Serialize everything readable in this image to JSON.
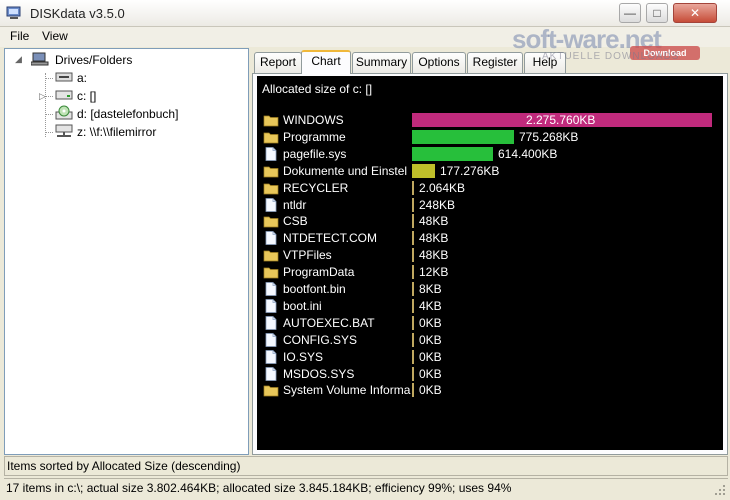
{
  "window": {
    "title": "DISKdata v3.5.0"
  },
  "watermark": {
    "text": "soft-ware.net",
    "badge": "Download",
    "sub": "AKTUELLE DOWNLOADS"
  },
  "menu": [
    {
      "label": "File"
    },
    {
      "label": "View"
    }
  ],
  "tree": {
    "root": "Drives/Folders",
    "items": [
      {
        "label": "a:",
        "icon": "floppy-drive-icon"
      },
      {
        "label": "c: []",
        "icon": "hard-drive-icon"
      },
      {
        "label": "d: [dastelefonbuch]",
        "icon": "cd-drive-icon"
      },
      {
        "label": "z: \\\\f:\\\\filemirror",
        "icon": "network-drive-icon"
      }
    ]
  },
  "tabs": [
    {
      "label": "Report"
    },
    {
      "label": "Chart"
    },
    {
      "label": "Summary"
    },
    {
      "label": "Options"
    },
    {
      "label": "Register"
    },
    {
      "label": "Help"
    }
  ],
  "chart": {
    "title": "Allocated size of c: []",
    "colors": {
      "magenta": "#c02a7c",
      "green": "#27bf3b",
      "olive": "#bfbf2a",
      "tick": "#c0a860"
    },
    "rows": [
      {
        "name": "WINDOWS",
        "value": "2.275.760KB",
        "kb": 2275760,
        "kind": "folder",
        "color": "#c02a7c",
        "label_inside": true
      },
      {
        "name": "Programme",
        "value": "775.268KB",
        "kb": 775268,
        "kind": "folder",
        "color": "#27bf3b"
      },
      {
        "name": "pagefile.sys",
        "value": "614.400KB",
        "kb": 614400,
        "kind": "file",
        "color": "#27bf3b"
      },
      {
        "name": "Dokumente und Einstel",
        "value": "177.276KB",
        "kb": 177276,
        "kind": "folder",
        "color": "#bfbf2a"
      },
      {
        "name": "RECYCLER",
        "value": "2.064KB",
        "kb": 2064,
        "kind": "folder",
        "color": "#c0a860"
      },
      {
        "name": "ntldr",
        "value": "248KB",
        "kb": 248,
        "kind": "file",
        "color": "#c0a860"
      },
      {
        "name": "CSB",
        "value": "48KB",
        "kb": 48,
        "kind": "folder",
        "color": "#c0a860"
      },
      {
        "name": "NTDETECT.COM",
        "value": "48KB",
        "kb": 48,
        "kind": "file",
        "color": "#c0a860"
      },
      {
        "name": "VTPFiles",
        "value": "48KB",
        "kb": 48,
        "kind": "folder",
        "color": "#c0a860"
      },
      {
        "name": "ProgramData",
        "value": "12KB",
        "kb": 12,
        "kind": "folder",
        "color": "#c0a860"
      },
      {
        "name": "bootfont.bin",
        "value": "8KB",
        "kb": 8,
        "kind": "file",
        "color": "#c0a860"
      },
      {
        "name": "boot.ini",
        "value": "4KB",
        "kb": 4,
        "kind": "file",
        "color": "#c0a860"
      },
      {
        "name": "AUTOEXEC.BAT",
        "value": "0KB",
        "kb": 0,
        "kind": "file",
        "color": "#c0a860"
      },
      {
        "name": "CONFIG.SYS",
        "value": "0KB",
        "kb": 0,
        "kind": "file",
        "color": "#c0a860"
      },
      {
        "name": "IO.SYS",
        "value": "0KB",
        "kb": 0,
        "kind": "file",
        "color": "#c0a860"
      },
      {
        "name": "MSDOS.SYS",
        "value": "0KB",
        "kb": 0,
        "kind": "file",
        "color": "#c0a860"
      },
      {
        "name": "System Volume Informa",
        "value": "0KB",
        "kb": 0,
        "kind": "folder",
        "color": "#c0a860"
      }
    ]
  },
  "status": {
    "sort": "Items sorted by Allocated Size (descending)",
    "summary": "17 items in c:\\; actual size 3.802.464KB; allocated size 3.845.184KB; efficiency 99%; uses 94%"
  }
}
